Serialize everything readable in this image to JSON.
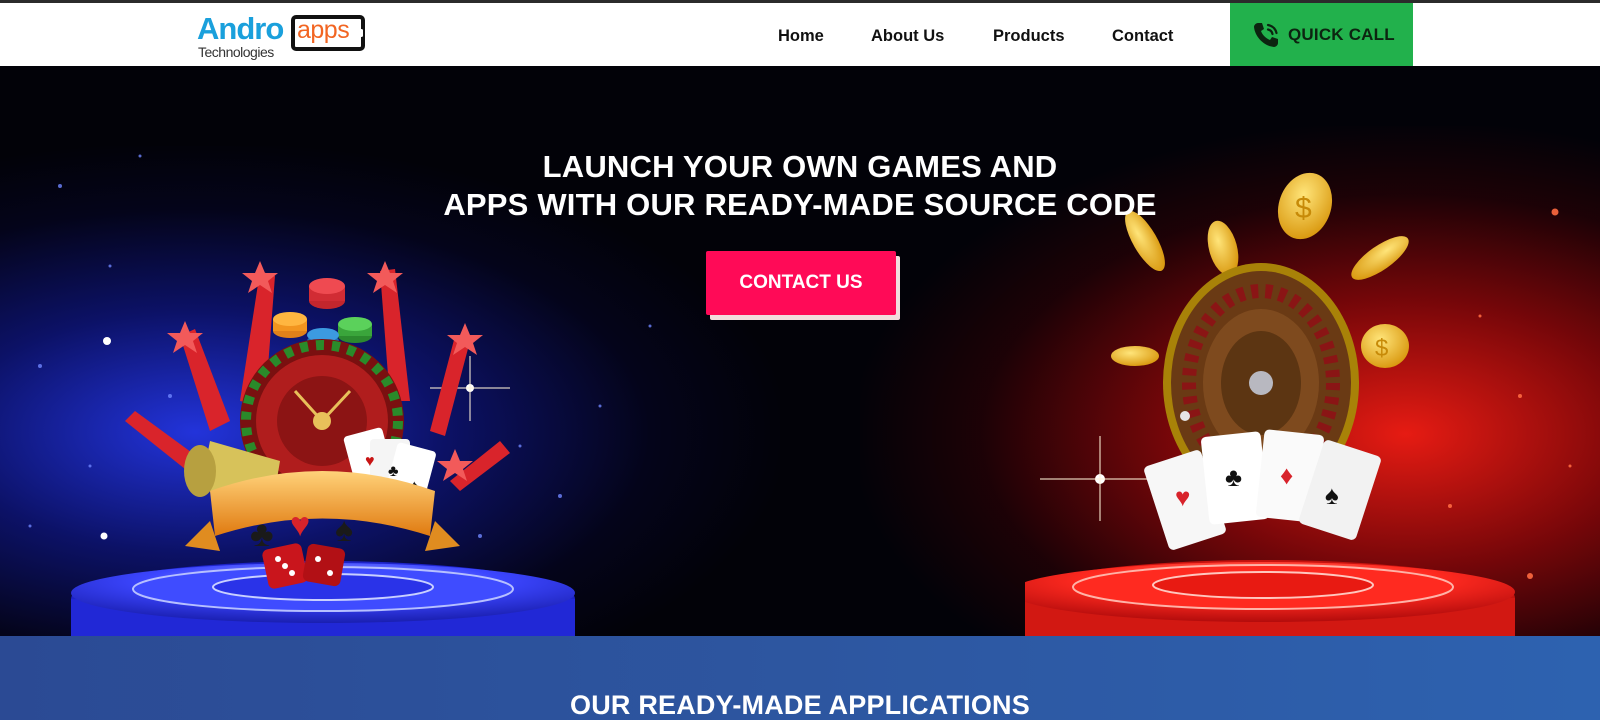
{
  "header": {
    "logo": {
      "primary": "Andro",
      "secondary": "apps",
      "tagline": "Technologies"
    },
    "nav": [
      {
        "label": "Home"
      },
      {
        "label": "About Us"
      },
      {
        "label": "Products"
      },
      {
        "label": "Contact"
      }
    ],
    "quick_call": {
      "label": "QUICK CALL",
      "icon": "phone-icon"
    }
  },
  "hero": {
    "title_line1": "LAUNCH YOUR OWN GAMES AND",
    "title_line2": "APPS WITH OUR READY-MADE SOURCE CODE",
    "cta_label": "CONTACT US",
    "images": [
      "casino-emblem-illustration",
      "roulette-cards-coins-illustration"
    ]
  },
  "apps_section": {
    "title": "OUR READY-MADE APPLICATIONS"
  },
  "colors": {
    "accent_green": "#22b14c",
    "cta_pink": "#ff0a57",
    "section_blue": "#2d56a0",
    "logo_blue": "#1aa0dc",
    "logo_orange": "#f26522"
  }
}
